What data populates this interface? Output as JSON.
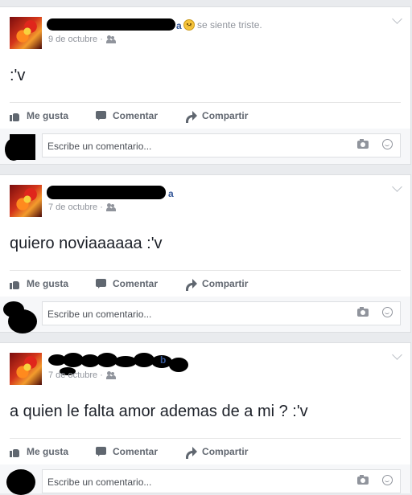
{
  "posts": [
    {
      "name_suffix": "a",
      "feeling": "se siente triste.",
      "date": "9 de octubre ·",
      "text": ":'v"
    },
    {
      "name_suffix": "a",
      "date": "7 de octubre ·",
      "text": "quiero noviaaaaaa :'v"
    },
    {
      "name_suffix": "b",
      "date": "7 de octubre ·",
      "text": "a quien le falta amor ademas de a mi ? :'v"
    }
  ],
  "actions": {
    "like": "Me gusta",
    "comment": "Comentar",
    "share": "Compartir"
  },
  "comment_placeholder": "Escribe un comentario...",
  "icons": [
    "sad-emoji-icon",
    "audience-friends-icon",
    "chevron-down-icon",
    "like-icon",
    "comment-icon",
    "share-icon",
    "camera-icon",
    "smiley-icon"
  ]
}
